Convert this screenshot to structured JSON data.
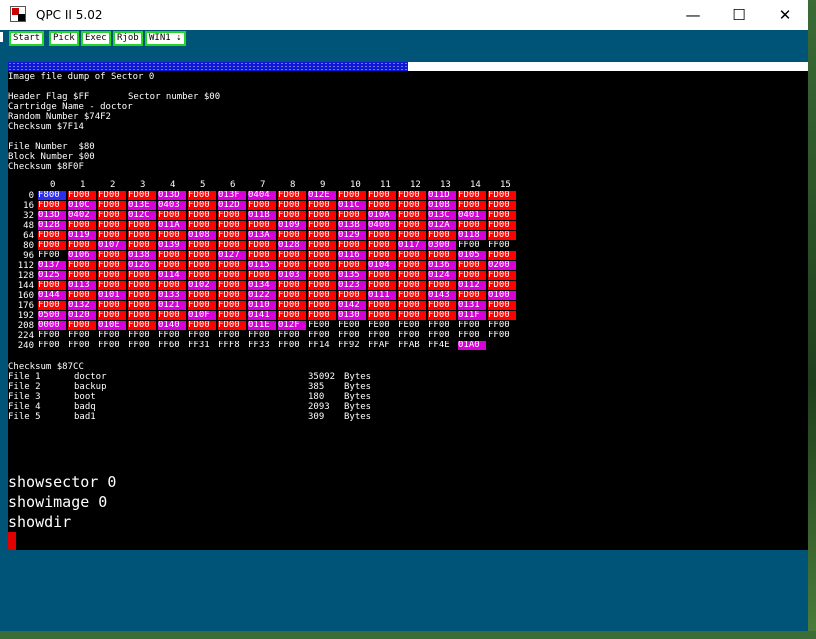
{
  "window": {
    "title": "QPC II 5.02",
    "minimize": "—",
    "maximize": "☐",
    "close": "✕"
  },
  "toolbar": {
    "buttons": [
      "Start",
      "Pick",
      "Exec",
      "Rjob",
      "WIN1 ⇣"
    ]
  },
  "progress": {
    "fraction": 0.5
  },
  "dump": {
    "title": "Image file dump of Sector 0",
    "header_flag": "Header Flag $FF",
    "sector_number": "Sector number $00",
    "cartridge_name": "Cartridge Name - doctor",
    "random_number": "Random Number $74F2",
    "checksum1": "Checksum $7F14",
    "file_number": "File Number  $80",
    "block_number": "Block Number $00",
    "checksum2": "Checksum $8F0F",
    "columns": [
      "0",
      "1",
      "2",
      "3",
      "4",
      "5",
      "6",
      "7",
      "8",
      "9",
      "10",
      "11",
      "12",
      "13",
      "14",
      "15"
    ],
    "rows": [
      {
        "label": "0",
        "cells": [
          "F800",
          "FD00",
          "FD00",
          "FD00",
          "013D",
          "FD00",
          "013F",
          "0404",
          "FD00",
          "012E",
          "FD00",
          "FD00",
          "FD00",
          "011D",
          "FD00",
          "FD00"
        ]
      },
      {
        "label": "16",
        "cells": [
          "FD00",
          "010C",
          "FD00",
          "013E",
          "0403",
          "FD00",
          "012D",
          "FD00",
          "FD00",
          "FD00",
          "011C",
          "FD00",
          "FD00",
          "010B",
          "FD00",
          "FD00"
        ]
      },
      {
        "label": "32",
        "cells": [
          "013D",
          "0402",
          "FD00",
          "012C",
          "FD00",
          "FD00",
          "FD00",
          "011B",
          "FD00",
          "FD00",
          "FD00",
          "010A",
          "FD00",
          "013C",
          "0401",
          "FD00"
        ]
      },
      {
        "label": "48",
        "cells": [
          "012B",
          "FD00",
          "FD00",
          "FD00",
          "011A",
          "FD00",
          "FD00",
          "FD00",
          "0109",
          "FD00",
          "013B",
          "0400",
          "FD00",
          "012A",
          "FD00",
          "FD00"
        ]
      },
      {
        "label": "64",
        "cells": [
          "FD00",
          "0119",
          "FD00",
          "FD00",
          "FD00",
          "0108",
          "FD00",
          "013A",
          "FD00",
          "FD00",
          "0129",
          "FD00",
          "FD00",
          "FD00",
          "0118",
          "FD00"
        ]
      },
      {
        "label": "80",
        "cells": [
          "FD00",
          "FD00",
          "0107",
          "FD00",
          "0139",
          "FD00",
          "FD00",
          "FD00",
          "0128",
          "FD00",
          "FD00",
          "FD00",
          "0117",
          "0300",
          "FF00",
          "FF00"
        ]
      },
      {
        "label": "96",
        "cells": [
          "FF00",
          "0106",
          "FD00",
          "0138",
          "FD00",
          "FD00",
          "0127",
          "FD00",
          "FD00",
          "FD00",
          "0116",
          "FD00",
          "FD00",
          "FD00",
          "0105",
          "FD00"
        ]
      },
      {
        "label": "112",
        "cells": [
          "0137",
          "FD00",
          "FD00",
          "0126",
          "FD00",
          "FD00",
          "FD00",
          "0115",
          "FD00",
          "FD00",
          "FD00",
          "0104",
          "FD00",
          "0136",
          "FD00",
          "0200"
        ]
      },
      {
        "label": "128",
        "cells": [
          "0125",
          "FD00",
          "FD00",
          "FD00",
          "0114",
          "FD00",
          "FD00",
          "FD00",
          "0103",
          "FD00",
          "0135",
          "FD00",
          "FD00",
          "0124",
          "FD00",
          "FD00"
        ]
      },
      {
        "label": "144",
        "cells": [
          "FD00",
          "0113",
          "FD00",
          "FD00",
          "FD00",
          "0102",
          "FD00",
          "0134",
          "FD00",
          "FD00",
          "0123",
          "FD00",
          "FD00",
          "FD00",
          "0112",
          "FD00"
        ]
      },
      {
        "label": "160",
        "cells": [
          "0144",
          "FD00",
          "0101",
          "FD00",
          "0133",
          "FD00",
          "FD00",
          "0122",
          "FD00",
          "FD00",
          "FD00",
          "0111",
          "FD00",
          "0143",
          "FD00",
          "0100"
        ]
      },
      {
        "label": "176",
        "cells": [
          "FD00",
          "0132",
          "FD00",
          "FD00",
          "0121",
          "FD00",
          "FD00",
          "0110",
          "FD00",
          "FD00",
          "0142",
          "FD00",
          "FD00",
          "FD00",
          "0131",
          "FD00"
        ]
      },
      {
        "label": "192",
        "cells": [
          "0500",
          "0120",
          "FD00",
          "FD00",
          "FD00",
          "010F",
          "FD00",
          "0141",
          "FD00",
          "FD00",
          "0130",
          "FD00",
          "FD00",
          "FD00",
          "011F",
          "FD00"
        ]
      },
      {
        "label": "208",
        "cells": [
          "0000",
          "FD00",
          "010E",
          "FD00",
          "0140",
          "FD00",
          "FD00",
          "011E",
          "012F",
          "FE00",
          "FE00",
          "FE00",
          "FE00",
          "FF00",
          "FF00",
          "FF00"
        ]
      },
      {
        "label": "224",
        "cells": [
          "FF00",
          "FF00",
          "FF00",
          "FF00",
          "FF00",
          "FF00",
          "FF00",
          "FF00",
          "FF00",
          "FF00",
          "FF00",
          "FF00",
          "FF00",
          "FF00",
          "FF00",
          "FF00"
        ]
      },
      {
        "label": "240",
        "cells": [
          "FF00",
          "FF00",
          "FF00",
          "FF00",
          "FF60",
          "FF31",
          "FFF8",
          "FF33",
          "FF00",
          "FF14",
          "FF92",
          "FFAF",
          "FFAB",
          "FF4E",
          "01A0",
          ""
        ]
      }
    ],
    "checksum3": "Checksum $87CC",
    "files": [
      {
        "label": "File 1",
        "name": "doctor",
        "size": "35092",
        "unit": "Bytes"
      },
      {
        "label": "File 2",
        "name": "backup",
        "size": "385",
        "unit": "Bytes"
      },
      {
        "label": "File 3",
        "name": "boot",
        "size": "180",
        "unit": "Bytes"
      },
      {
        "label": "File 4",
        "name": "badq",
        "size": "2093",
        "unit": "Bytes"
      },
      {
        "label": "File 5",
        "name": "bad1",
        "size": "309",
        "unit": "Bytes"
      }
    ]
  },
  "commands": [
    "showsector 0",
    "showimage 0",
    "showdir"
  ],
  "colors": {
    "fd00": "#ff0000",
    "data": "#d800d8",
    "f800": "#2d2df0",
    "plain": "#000000"
  }
}
